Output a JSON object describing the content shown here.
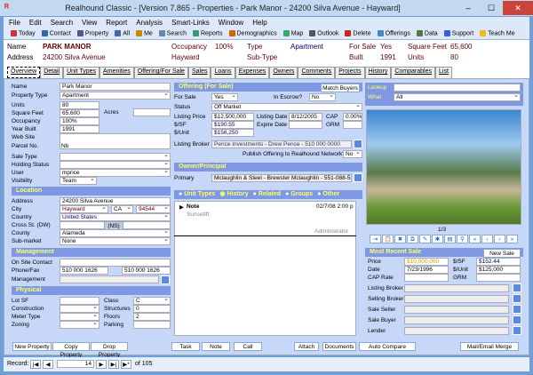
{
  "window": {
    "title": "Realhound Classic - [Version 7.865 - Properties - Park Manor - 24200 Silva Avenue - Hayward]",
    "min": "–",
    "max": "☐",
    "close": "✕"
  },
  "menu": [
    "File",
    "Edit",
    "Search",
    "View",
    "Report",
    "Analysis",
    "Smart-Links",
    "Window",
    "Help"
  ],
  "toolbar": [
    "Today",
    "Contact",
    "Property",
    "All",
    "Me",
    "Search",
    "Reports",
    "Demographics",
    "Map",
    "Outlook",
    "Delete",
    "Offerings",
    "Data",
    "Support",
    "Teach Me"
  ],
  "header": {
    "name_label": "Name",
    "name": "PARK MANOR",
    "address_label": "Address",
    "address": "24200 Silva Avenue",
    "occupancy_label": "Occupancy",
    "occupancy": "100%",
    "city": "Hayward",
    "type_label": "Type",
    "type": "Apartment",
    "subtype_label": "Sub-Type",
    "forsale_label": "For Sale",
    "forsale": "Yes",
    "built_label": "Built",
    "built": "1991",
    "sqft_label": "Square Feet",
    "sqft": "65,600",
    "units_label": "Units",
    "units": "80"
  },
  "tabs": [
    "Overview",
    "Detail",
    "Unit Types",
    "Amenities",
    "Offering/For Sale",
    "Sales",
    "Loans",
    "Expenses",
    "Owners",
    "Comments",
    "Projects",
    "History",
    "Comparables",
    "List"
  ],
  "left": {
    "name_label": "Name",
    "name": "Park Manor",
    "ptype_label": "Property Type",
    "ptype": "Apartment",
    "units_label": "Units",
    "units": "80",
    "acres_label": "Acres",
    "sqft_label": "Square Feet",
    "sqft": "65,600",
    "occ_label": "Occupancy",
    "occ": "100%",
    "built_label": "Year Built",
    "built": "1991",
    "web_label": "Web Site",
    "parcel_label": "Parcel No.",
    "parcel": "Nb",
    "sale_type_label": "Sale Type",
    "holding_label": "Holding Status",
    "user_label": "User",
    "user": "mprice",
    "visibility_label": "Visibility",
    "visibility": "Team",
    "location_title": "Location",
    "addr_label": "Address",
    "addr": "24200 Silva Avenue",
    "city_label": "City",
    "city": "Hayward",
    "state": "CA",
    "zip": "94544",
    "country_label": "Country",
    "country": "United States",
    "cross_label": "Cross St. (DW)",
    "nsew": "(NS)",
    "county_label": "County",
    "county": "Alameda",
    "submarket_label": "Sub-market",
    "submarket": "None",
    "mgmt_title": "Management",
    "onsite_label": "On Site Contact",
    "phone_label": "Phone/Fax",
    "phone": "510 000 1626",
    "fax": "510 000 1626",
    "mgmt_label": "Management",
    "phys_title": "Physical",
    "lot_label": "Lot SF",
    "class_label": "Class",
    "class": "C",
    "const_label": "Construction",
    "struct_label": "Structures",
    "struct": "0",
    "meter_label": "Meter Type",
    "floors_label": "Floors",
    "floors": "2",
    "zoning_label": "Zoning",
    "parking_label": "Parking",
    "new_btn": "New Property",
    "copy_btn": "Copy Property",
    "drop_btn": "Drop Property"
  },
  "offering": {
    "title": "Offering (For Sale)",
    "match_btn": "Match Buyers",
    "forsale_label": "For Sale",
    "forsale": "Yes",
    "escrow_label": "In Escrow?",
    "escrow": "No",
    "status_label": "Status",
    "status": "Off Market",
    "lp_label": "Listing Price",
    "lp": "$12,500,000",
    "ld_label": "Listing Date",
    "ld": "8/12/2005",
    "cap_label": "CAP",
    "cap": "0.00%",
    "psf_label": "$/SF",
    "psf": "$190.55",
    "exp_label": "Expire Date",
    "grm_label": "GRM",
    "pu_label": "$/Unit",
    "pu": "$156,250",
    "broker_label": "Listing Broker",
    "broker": "Pence Investments - Drew Pence - 510 000 0000",
    "publish_label": "Publish Offering to Realhound Network?",
    "publish": "No"
  },
  "owner": {
    "title": "Owner/Principal",
    "primary_label": "Primary",
    "primary": "Mclaughlin & Steel - Brewster Mclaughlin - 551-088-5555"
  },
  "history": {
    "radios": [
      "Unit Types",
      "History",
      "Related",
      "Groups",
      "Other"
    ],
    "entry_type": "Note",
    "entry_date": "02/7/08 2:00 p",
    "entry_text": "Sunsetlft",
    "entry_user": "Administrator"
  },
  "right": {
    "lookup_label": "Lookup",
    "what_label": "What",
    "what": "All",
    "photo_count": "1/3",
    "recent_title": "Most Recent Sale",
    "new_sale": "New Sale",
    "price_label": "Price",
    "price": "$10,000,000",
    "psf_label": "$/SF",
    "psf": "$152.44",
    "date_label": "Date",
    "date": "7/23/1996",
    "pu_label": "$/Unit",
    "pu": "$125,000",
    "cap_label": "CAP Rate",
    "grm_label": "GRM",
    "lb_label": "Listing Broker",
    "sb_label": "Selling Broker",
    "seller_label": "Sale Seller",
    "buyer_label": "Sale Buyer",
    "lender_label": "Lender"
  },
  "bottom": {
    "task": "Task",
    "note": "Note",
    "call": "Call",
    "attach": "Attach",
    "documents": "Documents",
    "auto": "Auto Compare",
    "mail": "Mail/Email Merge"
  },
  "records": {
    "label": "Record:",
    "current": "14",
    "of": "of 105",
    "first": "|◀",
    "prev": "◀",
    "next": "▶",
    "last": "▶|",
    "new": "▶*"
  }
}
